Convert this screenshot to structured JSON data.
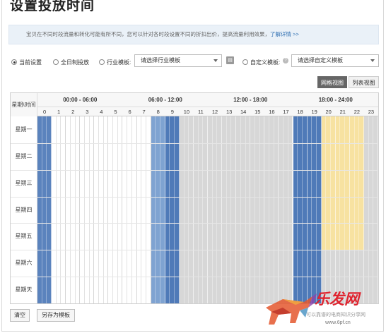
{
  "title": "设置投放时间",
  "info": {
    "text": "宝贝在不同时段流量和转化可能有所不同，您可以针对各时段设置不同的折扣出价，提高流量利用效果，",
    "link": "了解详情 >>"
  },
  "options": {
    "current": "当前设置",
    "allday": "全日制投放",
    "industry": "行业模板:",
    "industry_select": "请选择行业模板",
    "custom": "自定义模板:",
    "custom_select": "请选择自定义模板",
    "selected": "current"
  },
  "view": {
    "grid": "网格视图",
    "list": "列表视图"
  },
  "schedule": {
    "corner": "星期\\时间",
    "groups": [
      "00:00 - 06:00",
      "06:00 - 12:00",
      "12:00 - 18:00",
      "18:00 - 24:00"
    ],
    "hours": [
      "0",
      "1",
      "2",
      "3",
      "4",
      "5",
      "6",
      "7",
      "8",
      "9",
      "10",
      "11",
      "12",
      "13",
      "14",
      "15",
      "16",
      "17",
      "18",
      "19",
      "20",
      "21",
      "22",
      "23"
    ],
    "days": [
      "星期一",
      "星期二",
      "星期三",
      "星期四",
      "星期五",
      "星期六",
      "星期天"
    ],
    "colors": {
      "dark": "#4f7ab8",
      "mid": "#7fa3d1",
      "light": "#a9c4e4",
      "white": "#ffffff",
      "grey": "#d7d7d7",
      "yellow": "#f7e2a1"
    },
    "hour_levels": [
      "dark",
      "white",
      "white",
      "white",
      "white",
      "white",
      "white",
      "white",
      "mid",
      "dark",
      "grey",
      "grey",
      "grey",
      "grey",
      "grey",
      "grey",
      "grey",
      "grey",
      "dark",
      "dark",
      "grey",
      "grey",
      "grey",
      "grey"
    ],
    "weekday_override": {
      "hours": [
        20,
        21,
        22
      ],
      "level": "yellow",
      "days": [
        0,
        1,
        2,
        3,
        4
      ]
    },
    "day_zero_color": "#5b83bd"
  },
  "footer": {
    "clear": "清空",
    "save_template": "另存为模板"
  },
  "watermark": {
    "brand": "乐发网",
    "slogan": "可以靠谱的电商知识分享网",
    "url": "www.6pf.cn"
  }
}
